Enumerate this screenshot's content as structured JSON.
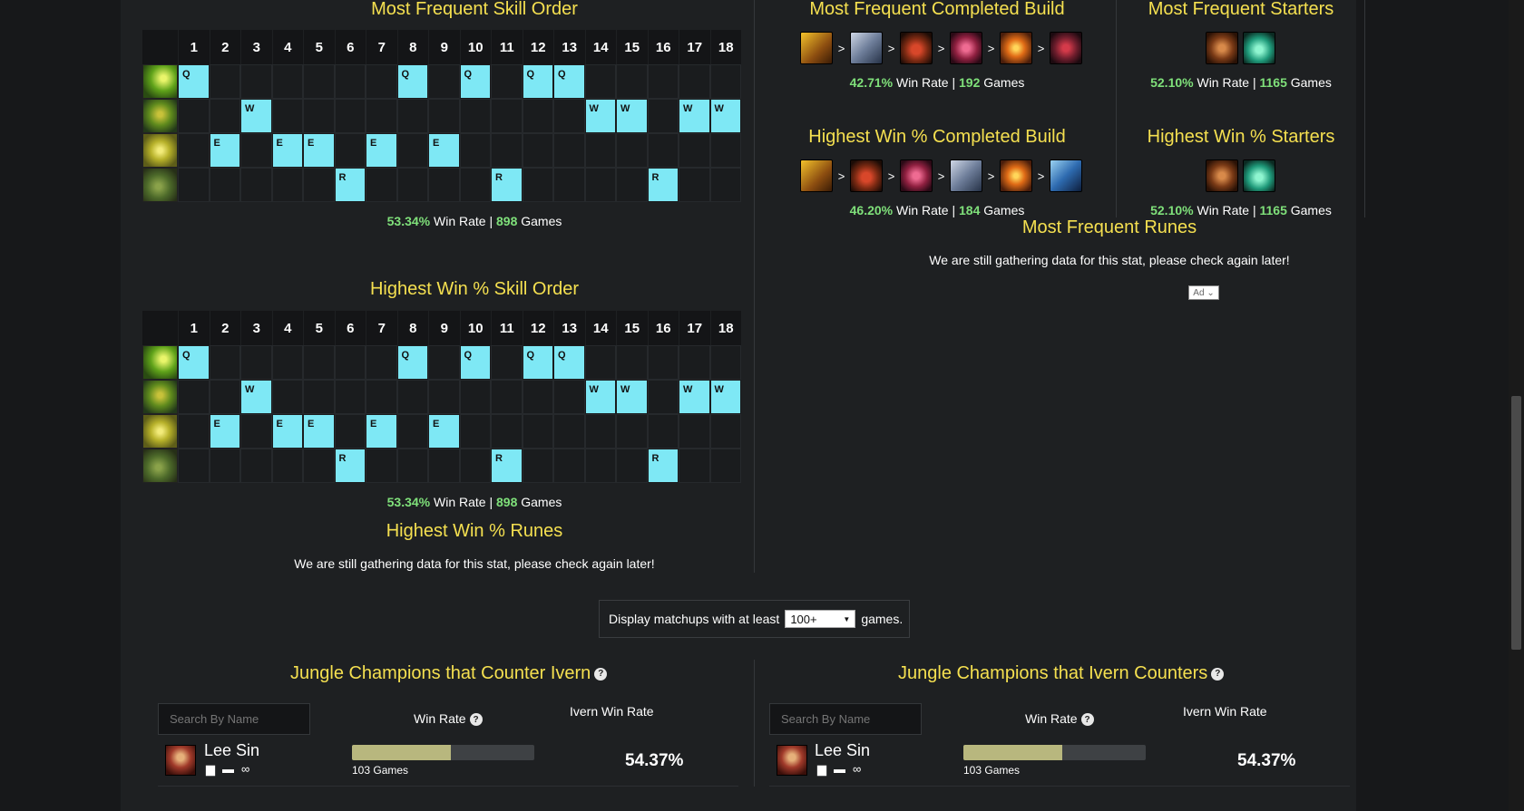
{
  "skill_order_frequent": {
    "title": "Most Frequent Skill Order",
    "levels": [
      "1",
      "2",
      "3",
      "4",
      "5",
      "6",
      "7",
      "8",
      "9",
      "10",
      "11",
      "12",
      "13",
      "14",
      "15",
      "16",
      "17",
      "18"
    ],
    "rows": [
      {
        "skill": "Q",
        "icon": "ivern-q-icon",
        "levels": [
          1,
          8,
          10,
          12,
          13
        ]
      },
      {
        "skill": "W",
        "icon": "ivern-w-icon",
        "levels": [
          3,
          14,
          15,
          17,
          18
        ]
      },
      {
        "skill": "E",
        "icon": "ivern-e-icon",
        "levels": [
          2,
          4,
          5,
          7,
          9
        ]
      },
      {
        "skill": "R",
        "icon": "ivern-r-icon",
        "levels": [
          6,
          11,
          16
        ]
      }
    ],
    "win_rate": "53.34%",
    "win_rate_label": "Win Rate |",
    "games": "898",
    "games_label": "Games"
  },
  "skill_order_highest": {
    "title": "Highest Win % Skill Order",
    "win_rate": "53.34%",
    "win_rate_label": "Win Rate |",
    "games": "898",
    "games_label": "Games"
  },
  "runes_highest": {
    "title": "Highest Win % Runes",
    "message": "We are still gathering data for this stat, please check again later!"
  },
  "runes_frequent": {
    "title": "Most Frequent Runes",
    "message": "We are still gathering data for this stat, please check again later!"
  },
  "build_frequent": {
    "title": "Most Frequent Completed Build",
    "items": [
      "boots-of-mobility-icon",
      "redemption-icon",
      "ruby-sightstone-icon",
      "knights-vow-icon",
      "locket-of-iron-solari-icon",
      "zekes-convergence-icon"
    ],
    "arrow": ">",
    "win_rate": "42.71%",
    "win_rate_label": "Win Rate |",
    "games": "192",
    "games_label": "Games"
  },
  "build_highest": {
    "title": "Highest Win % Completed Build",
    "items": [
      "boots-of-mobility-icon",
      "ruby-sightstone-icon",
      "knights-vow-icon",
      "redemption-icon",
      "locket-of-iron-solari-icon",
      "athenes-unholy-grail-icon"
    ],
    "arrow": ">",
    "win_rate": "46.20%",
    "win_rate_label": "Win Rate |",
    "games": "184",
    "games_label": "Games"
  },
  "starters_frequent": {
    "title": "Most Frequent Starters",
    "items": [
      "hunters-talisman-icon",
      "refillable-potion-icon"
    ],
    "win_rate": "52.10%",
    "win_rate_label": "Win Rate |",
    "games": "1165",
    "games_label": "Games"
  },
  "starters_highest": {
    "title": "Highest Win % Starters",
    "items": [
      "hunters-talisman-icon",
      "refillable-potion-icon"
    ],
    "win_rate": "52.10%",
    "win_rate_label": "Win Rate |",
    "games": "1165",
    "games_label": "Games"
  },
  "ad": {
    "label": "Ad",
    "chevron": "⌄"
  },
  "matchup_filter": {
    "prefix": "Display matchups with at least",
    "selected": "100+",
    "caret": "▼",
    "suffix": "games."
  },
  "counters": {
    "title": "Jungle Champions that Counter Ivern",
    "search_placeholder": "Search By Name",
    "col_win_rate": "Win Rate",
    "col_ivern_win_rate": "Ivern Win Rate",
    "rows": [
      {
        "name": "Lee Sin",
        "games": "103 Games",
        "win_rate_fraction": 0.5437,
        "ivern_win_rate": "54.37%"
      }
    ]
  },
  "countered": {
    "title": "Jungle Champions that Ivern Counters",
    "search_placeholder": "Search By Name",
    "col_win_rate": "Win Rate",
    "col_ivern_win_rate": "Ivern Win Rate",
    "rows": [
      {
        "name": "Lee Sin",
        "games": "103 Games",
        "win_rate_fraction": 0.5437,
        "ivern_win_rate": "54.37%"
      }
    ]
  },
  "help_glyph": "?",
  "row_icons": [
    "stats-icon",
    "comment-icon",
    "link-icon"
  ]
}
